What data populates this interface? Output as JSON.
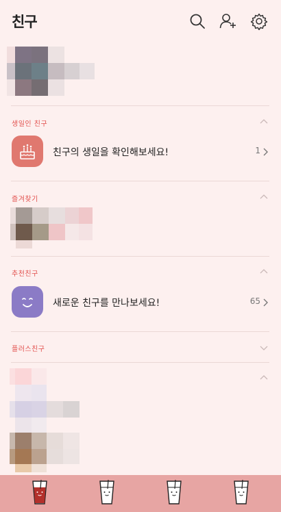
{
  "header": {
    "title": "친구",
    "icons": [
      "search-icon",
      "add-friend-icon",
      "settings-icon"
    ]
  },
  "sections": {
    "birthday": {
      "label": "생일인 친구",
      "row_text": "친구의 생일을 확인해보세요!",
      "count": "1",
      "icon": "birthday-cake-icon"
    },
    "favorites": {
      "label": "즐겨찾기"
    },
    "recommended": {
      "label": "추천친구",
      "row_text": "새로운 친구를 만나보세요!",
      "count": "65",
      "icon": "smiley-face-icon"
    },
    "plus": {
      "label": "플러스친구"
    }
  },
  "tabbar": {
    "tabs": [
      "friends-tab",
      "chats-tab",
      "search-tab",
      "more-tab"
    ],
    "active": "friends-tab"
  },
  "colors": {
    "background": "#fdf0ef",
    "accent": "#e2504d",
    "tabbar": "#e7a5a3",
    "birthday_avatar": "#e0786f",
    "recommended_avatar": "#8b7bc6"
  }
}
